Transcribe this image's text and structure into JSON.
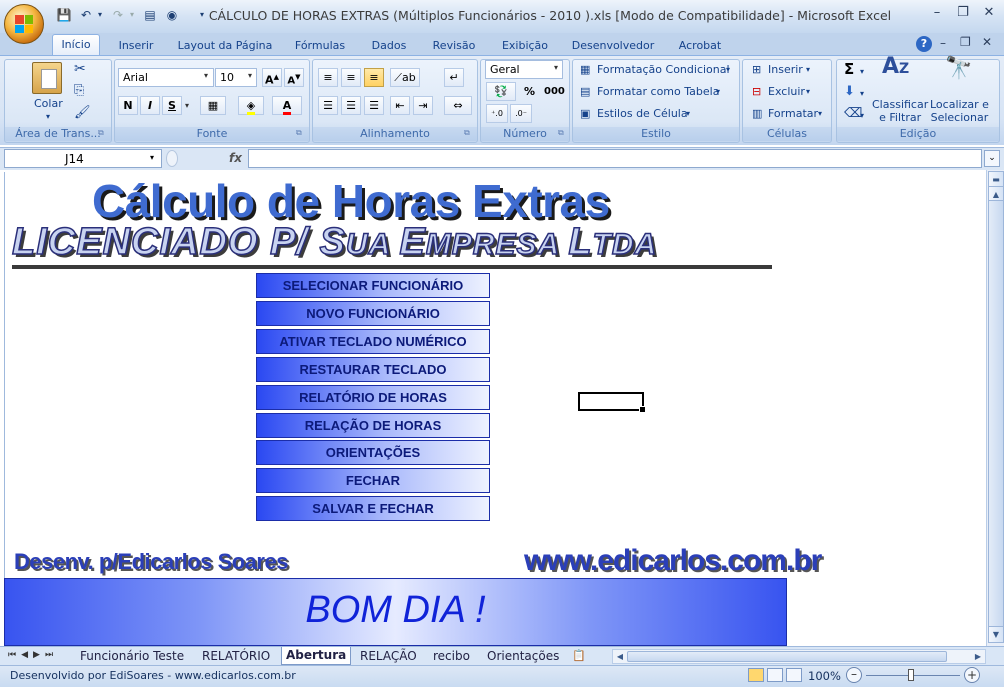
{
  "window": {
    "title": "CÁLCULO DE HORAS EXTRAS (Múltiplos Funcionários - 2010 ).xls  [Modo de Compatibilidade] - Microsoft Excel"
  },
  "ribbon_tabs": [
    "Início",
    "Inserir",
    "Layout da Página",
    "Fórmulas",
    "Dados",
    "Revisão",
    "Exibição",
    "Desenvolvedor",
    "Acrobat"
  ],
  "ribbon": {
    "clipboard": {
      "paste": "Colar",
      "label": "Área de Trans..."
    },
    "font": {
      "name": "Arial",
      "size": "10",
      "bold": "N",
      "italic": "I",
      "underline": "S",
      "label": "Fonte"
    },
    "alignment": {
      "label": "Alinhamento"
    },
    "number": {
      "format": "Geral",
      "percent": "%",
      "thousands": "000",
      "label": "Número"
    },
    "style": {
      "conditional": "Formatação Condicional",
      "as_table": "Formatar como Tabela",
      "cell_styles": "Estilos de Célula",
      "label": "Estilo"
    },
    "cells": {
      "insert": "Inserir",
      "delete": "Excluir",
      "format": "Formatar",
      "label": "Células"
    },
    "editing": {
      "sort": "Classificar\ne Filtrar",
      "find": "Localizar e\nSelecionar",
      "label": "Edição"
    }
  },
  "formula_bar": {
    "name_box": "J14",
    "fx": "fx",
    "formula": ""
  },
  "sheet": {
    "title": "Cálculo de Horas Extras",
    "subtitle_a": "LICENCIADO P/  S",
    "subtitle_b": "UA ",
    "subtitle_c": "E",
    "subtitle_d": "MPRESA ",
    "subtitle_e": "L",
    "subtitle_f": "TDA",
    "menu_buttons": [
      "SELECIONAR FUNCIONÁRIO",
      "NOVO FUNCIONÁRIO",
      "ATIVAR TECLADO NUMÉRICO",
      "RESTAURAR TECLADO",
      "RELATÓRIO DE HORAS",
      "RELAÇÃO DE HORAS",
      "ORIENTAÇÕES",
      "FECHAR",
      "SALVAR E FECHAR"
    ],
    "credit": "Desenv. p/Edicarlos Soares",
    "website": "www.edicarlos.com.br",
    "greeting": "BOM DIA !"
  },
  "sheet_tabs": [
    "Funcionário Teste",
    "RELATÓRIO",
    "Abertura",
    "RELAÇÃO",
    "recibo",
    "Orientações"
  ],
  "active_sheet_tab": "Abertura",
  "status": {
    "text": "Desenvolvido por EdiSoares - www.edicarlos.com.br",
    "zoom": "100%"
  },
  "colors": {
    "button_blue": "#2a48f2",
    "title_blue": "#3f6bd0",
    "ribbon_bg": "#d7e4f5"
  }
}
